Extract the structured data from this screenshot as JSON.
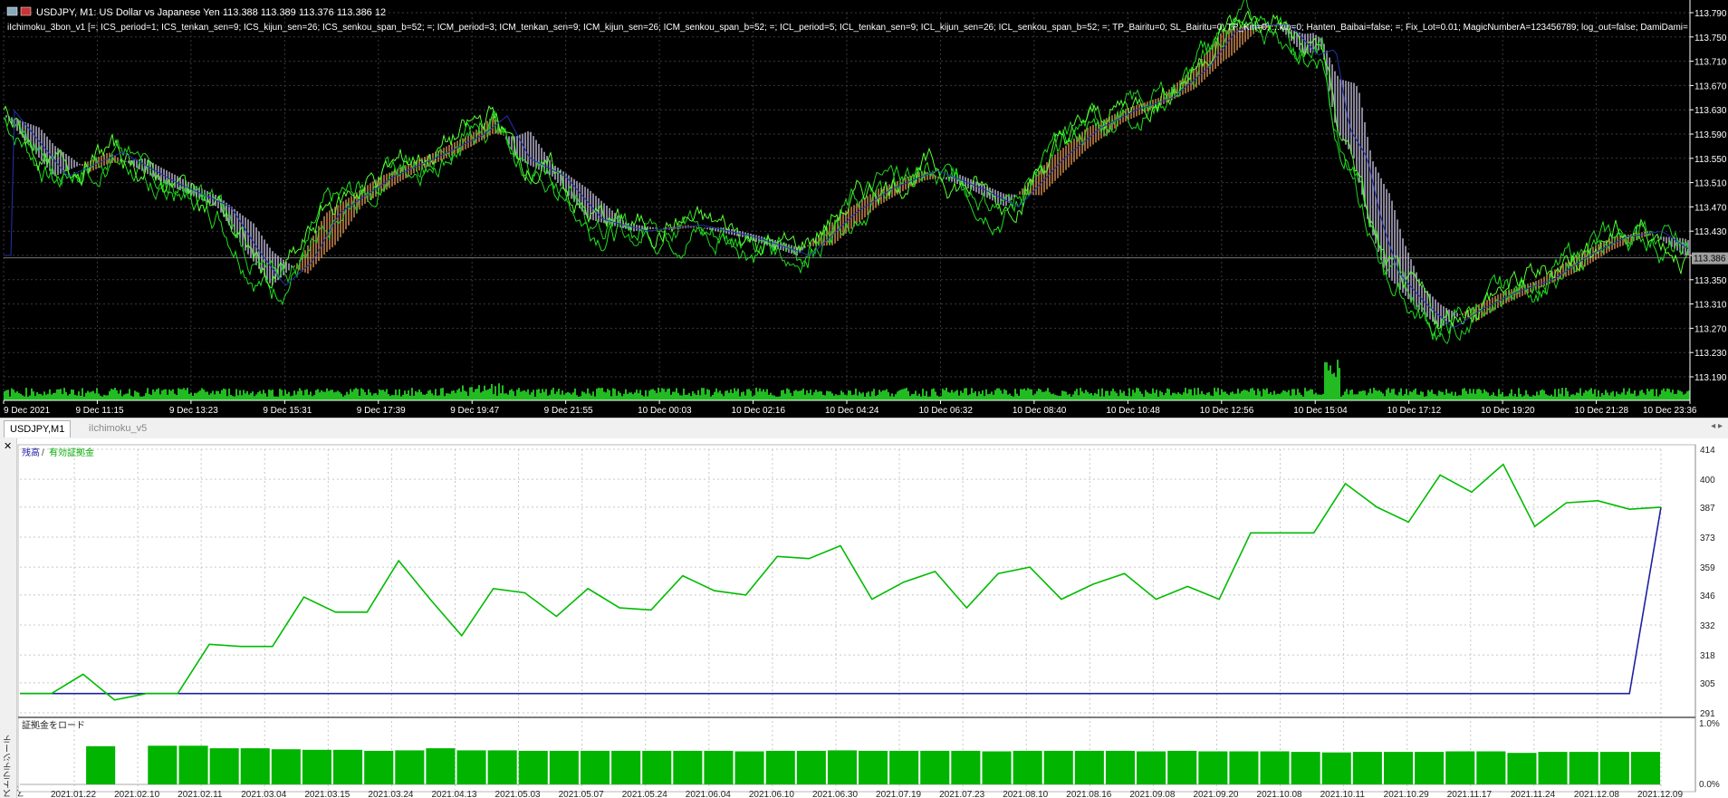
{
  "price_chart": {
    "header": "USDJPY, M1:  US Dollar vs Japanese Yen  113.388 113.389 113.376 113.386  12",
    "indicator_params": "iIchimoku_3bon_v1 [=; ICS_period=1; ICS_tenkan_sen=9; ICS_kijun_sen=26; ICS_senkou_span_b=52; =; ICM_period=3; ICM_tenkan_sen=9; ICM_kijun_sen=26; ICM_senkou_span_b=52; =; ICL_period=5; ICL_tenkan_sen=9; ICL_kijun_sen=26; ICL_senkou_span_b=52; =; TP_Bairitu=0; SL_Bairitu=0; TP_Kiri=0; ...kin=0; Hanten_Baibai=false; =; Fix_Lot=0.01; MagicNumberA=123456789; log_out=false; DamiDami=",
    "price_levels": [
      "113.790",
      "113.750",
      "113.710",
      "113.670",
      "113.630",
      "113.590",
      "113.550",
      "113.510",
      "113.470",
      "113.430",
      "113.390",
      "113.350",
      "113.310",
      "113.270",
      "113.230",
      "113.190"
    ],
    "current_price": "113.386",
    "time_labels": [
      "9 Dec 2021",
      "9 Dec 11:15",
      "9 Dec 13:23",
      "9 Dec 15:31",
      "9 Dec 17:39",
      "9 Dec 19:47",
      "9 Dec 21:55",
      "10 Dec 00:03",
      "10 Dec 02:16",
      "10 Dec 04:24",
      "10 Dec 06:32",
      "10 Dec 08:40",
      "10 Dec 10:48",
      "10 Dec 12:56",
      "10 Dec 15:04",
      "10 Dec 17:12",
      "10 Dec 19:20",
      "10 Dec 21:28",
      "10 Dec 23:36"
    ],
    "colors": {
      "price_line": "#22dd22",
      "kumo_up": "#f0a060",
      "kumo_down": "#d8d0f0",
      "volume": "#22bb22",
      "axis_text": "#ffffff",
      "grid": "#3a3a3a",
      "current_price_bg": "#a0a0a0"
    }
  },
  "tabs": [
    {
      "label": "USDJPY,M1",
      "active": true
    },
    {
      "label": "iIchimoku_v5",
      "active": false
    }
  ],
  "tabbar_scroll_icon": "arrow-left-right",
  "tester": {
    "close_glyph": "✕",
    "side_title": "ストラテジーテスター",
    "legend_balance": "残高",
    "legend_separator": "/",
    "legend_equity": "有効証拠金",
    "margin_label": "証拠金をロード",
    "margin_scale": [
      "1.0%",
      "0.0%"
    ],
    "colors": {
      "balance": "#2020a0",
      "equity": "#00bb00",
      "margin_bars": "#00b400",
      "grid": "#c8c8c8"
    }
  },
  "chart_data": [
    {
      "type": "line",
      "title": "",
      "series": [
        {
          "name": "残高",
          "values": [
            300,
            300,
            300,
            300,
            300,
            300,
            300,
            300,
            300,
            300,
            300,
            300,
            300,
            300,
            300,
            300,
            300,
            300,
            300,
            300,
            300,
            300,
            300,
            300,
            300,
            300,
            300,
            300,
            300,
            300,
            300,
            300,
            300,
            300,
            300,
            300,
            300,
            300,
            300,
            300,
            300,
            300,
            300,
            300,
            300,
            300,
            300,
            300,
            300,
            300,
            300,
            300,
            387
          ]
        },
        {
          "name": "有効証拠金",
          "values": [
            300,
            300,
            309,
            297,
            300,
            300,
            323,
            322,
            322,
            345,
            338,
            338,
            362,
            344,
            327,
            349,
            347,
            336,
            349,
            340,
            339,
            355,
            348,
            346,
            364,
            363,
            369,
            344,
            352,
            357,
            340,
            356,
            359,
            344,
            351,
            356,
            344,
            350,
            344,
            375,
            375,
            375,
            398,
            387,
            380,
            402,
            394,
            407,
            378,
            389,
            390,
            386,
            387
          ]
        }
      ],
      "x_labels": [
        "2021.01.22",
        "2021.02.10",
        "2021.02.11",
        "2021.03.04",
        "2021.03.15",
        "2021.03.24",
        "2021.04.13",
        "2021.05.03",
        "2021.05.07",
        "2021.05.24",
        "2021.06.04",
        "2021.06.10",
        "2021.06.30",
        "2021.07.19",
        "2021.07.23",
        "2021.08.10",
        "2021.08.16",
        "2021.09.08",
        "2021.09.20",
        "2021.10.08",
        "2021.10.11",
        "2021.10.29",
        "2021.11.17",
        "2021.11.24",
        "2021.12.08",
        "2021.12.09"
      ],
      "y_ticks": [
        414,
        400,
        387,
        373,
        359,
        346,
        332,
        318,
        305,
        291
      ],
      "ylim": [
        291,
        414
      ],
      "grid": true
    },
    {
      "type": "bar",
      "title": "証拠金をロード",
      "values": [
        0,
        0.74,
        0,
        0.75,
        0.75,
        0.7,
        0.7,
        0.68,
        0.67,
        0.67,
        0.65,
        0.66,
        0.7,
        0.66,
        0.66,
        0.65,
        0.65,
        0.65,
        0.65,
        0.65,
        0.65,
        0.65,
        0.64,
        0.65,
        0.65,
        0.66,
        0.65,
        0.65,
        0.65,
        0.65,
        0.64,
        0.65,
        0.65,
        0.65,
        0.65,
        0.64,
        0.65,
        0.64,
        0.64,
        0.64,
        0.63,
        0.62,
        0.63,
        0.63,
        0.63,
        0.64,
        0.64,
        0.61,
        0.63,
        0.63,
        0.63,
        0.63
      ],
      "ylim": [
        0,
        1.0
      ],
      "y_ticks": [
        "1.0%",
        "0.0%"
      ]
    }
  ]
}
